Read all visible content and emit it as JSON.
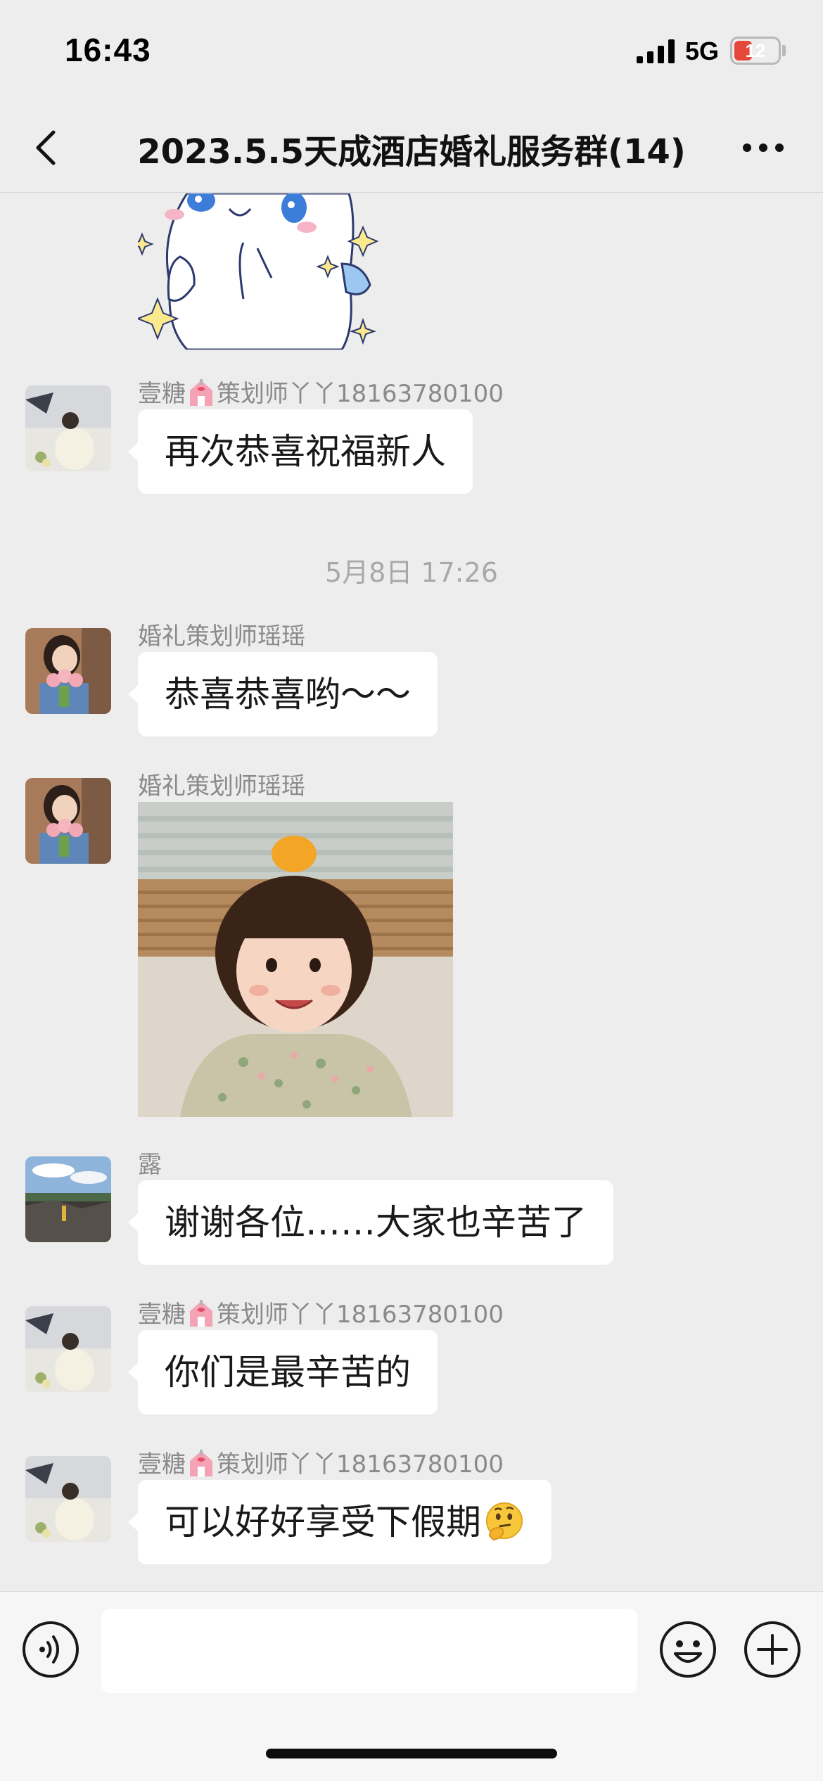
{
  "status": {
    "time": "16:43",
    "network": "5G",
    "battery": "12",
    "battery_level": 0.12
  },
  "header": {
    "title": "2023.5.5天成酒店婚礼服务群(14)"
  },
  "messages": [
    {
      "sender_prefix": "壹糖",
      "sender_suffix": "策划师丫丫18163780100",
      "text": "再次恭喜祝福新人"
    },
    {
      "timestamp": "5月8日 17:26"
    },
    {
      "sender": "婚礼策划师瑶瑶",
      "text": "恭喜恭喜哟～～"
    },
    {
      "sender": "婚礼策划师瑶瑶",
      "image": "photo-of-girl-with-orange"
    },
    {
      "sender": "露",
      "text": "谢谢各位……大家也辛苦了"
    },
    {
      "sender_prefix": "壹糖",
      "sender_suffix": "策划师丫丫18163780100",
      "text": "你们是最辛苦的"
    },
    {
      "sender_prefix": "壹糖",
      "sender_suffix": "策划师丫丫18163780100",
      "text": "可以好好享受下假期",
      "emoji": "thinking-face-icon"
    }
  ],
  "input": {
    "value": "",
    "placeholder": ""
  },
  "icons": {
    "back": "chevron-left-icon",
    "more": "ellipsis-icon",
    "voice": "voice-icon",
    "emoji": "smiley-icon",
    "plus": "plus-icon"
  },
  "colors": {
    "background": "#ededed",
    "bubble": "#ffffff",
    "sender_name": "#8a8a8a",
    "timestamp": "#a8a8a8",
    "battery_low": "#e5483a"
  }
}
